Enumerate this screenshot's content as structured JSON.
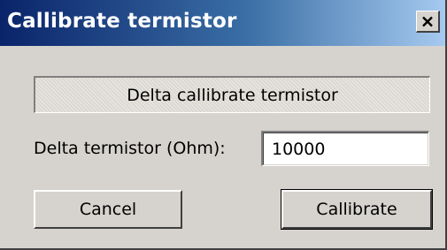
{
  "window": {
    "title": "Callibrate termistor",
    "close_icon": "close-x-icon"
  },
  "group": {
    "label": "Delta callibrate termistor"
  },
  "form": {
    "delta_label": "Delta termistor (Ohm):",
    "delta_value": "10000"
  },
  "buttons": {
    "cancel_label": "Cancel",
    "calibrate_label": "Callibrate"
  },
  "colors": {
    "title_bar_start": "#0a246a",
    "title_bar_end": "#a6caf0",
    "dialog_face": "#d6d3ce"
  }
}
